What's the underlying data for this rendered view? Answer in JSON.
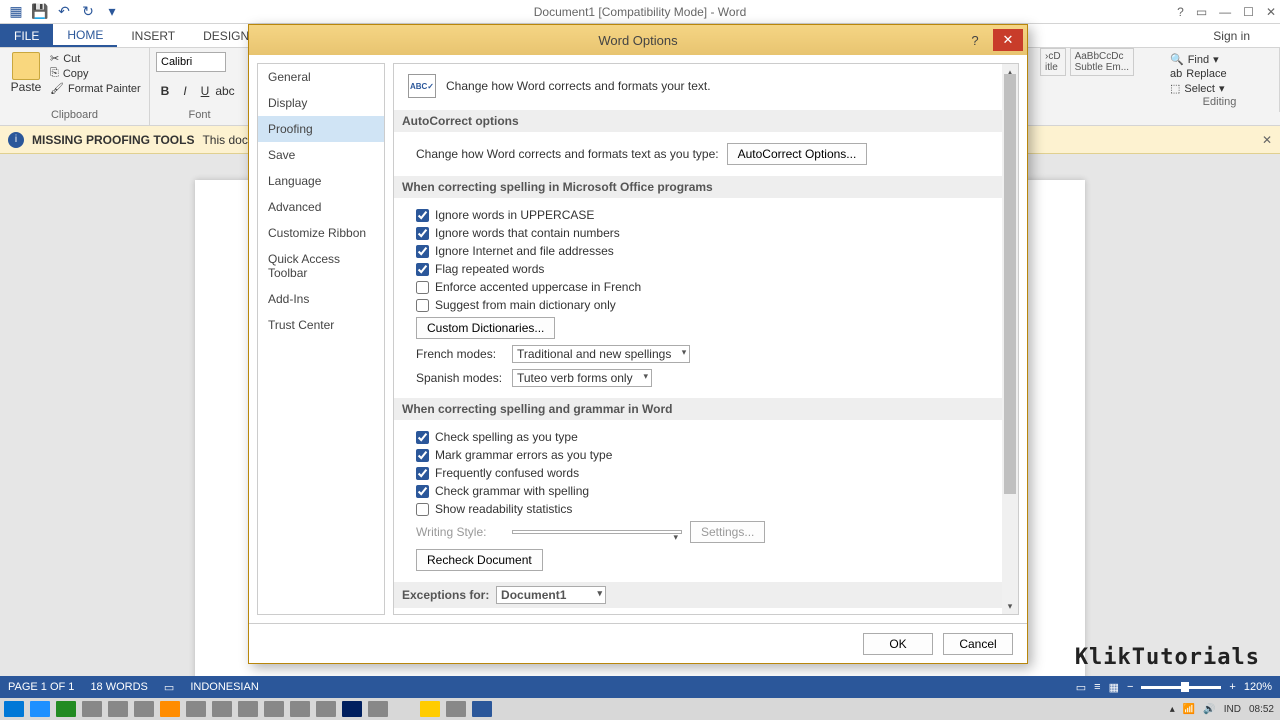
{
  "window": {
    "title": "Document1 [Compatibility Mode] - Word",
    "signin": "Sign in"
  },
  "tabs": {
    "file": "FILE",
    "home": "HOME",
    "insert": "INSERT",
    "design": "DESIGN"
  },
  "ribbon": {
    "clipboard": {
      "label": "Clipboard",
      "paste": "Paste",
      "cut": "Cut",
      "copy": "Copy",
      "format_painter": "Format Painter"
    },
    "font": {
      "label": "Font",
      "name": "Calibri"
    },
    "styles": {
      "s1": "›cD",
      "s2": "AaBbCcDc",
      "t1": "itle",
      "t2": "Subtle Em..."
    },
    "editing": {
      "label": "Editing",
      "find": "Find",
      "replace": "Replace",
      "select": "Select"
    }
  },
  "msgbar": {
    "title": "MISSING PROOFING TOOLS",
    "text": "This docun"
  },
  "dialog": {
    "title": "Word Options",
    "nav": [
      "General",
      "Display",
      "Proofing",
      "Save",
      "Language",
      "Advanced",
      "Customize Ribbon",
      "Quick Access Toolbar",
      "Add-Ins",
      "Trust Center"
    ],
    "intro": "Change how Word corrects and formats your text.",
    "s_autocorrect": "AutoCorrect options",
    "autocorrect_text": "Change how Word corrects and formats text as you type:",
    "autocorrect_btn": "AutoCorrect Options...",
    "s_office": "When correcting spelling in Microsoft Office programs",
    "cb1": "Ignore words in UPPERCASE",
    "cb2": "Ignore words that contain numbers",
    "cb3": "Ignore Internet and file addresses",
    "cb4": "Flag repeated words",
    "cb5": "Enforce accented uppercase in French",
    "cb6": "Suggest from main dictionary only",
    "custom_dict": "Custom Dictionaries...",
    "french_label": "French modes:",
    "french_val": "Traditional and new spellings",
    "spanish_label": "Spanish modes:",
    "spanish_val": "Tuteo verb forms only",
    "s_word": "When correcting spelling and grammar in Word",
    "cb7": "Check spelling as you type",
    "cb8": "Mark grammar errors as you type",
    "cb9": "Frequently confused words",
    "cb10": "Check grammar with spelling",
    "cb11": "Show readability statistics",
    "writing_style": "Writing Style:",
    "settings": "Settings...",
    "recheck": "Recheck Document",
    "exceptions": "Exceptions for:",
    "exceptions_val": "Document1",
    "ok": "OK",
    "cancel": "Cancel"
  },
  "status": {
    "page": "PAGE 1 OF 1",
    "words": "18 WORDS",
    "lang": "INDONESIAN",
    "zoom": "120%"
  },
  "taskbar": {
    "lang": "IND",
    "time": "08:52"
  },
  "watermark": "KlikTutorials"
}
